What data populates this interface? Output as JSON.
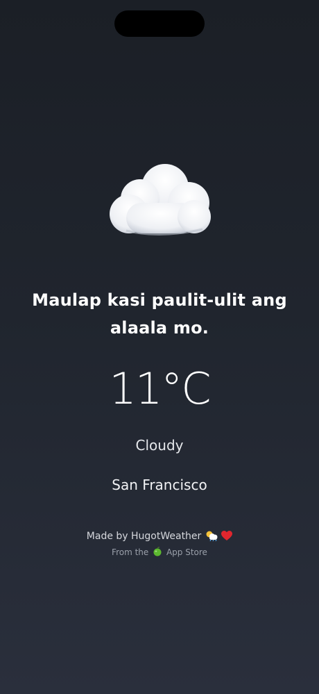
{
  "weather": {
    "quote": "Maulap kasi paulit-ulit ang alaala mo.",
    "temperature": "11°C",
    "condition": "Cloudy",
    "city": "San Francisco",
    "icon": "cloud-icon"
  },
  "footer": {
    "made_by": "Made by HugotWeather",
    "from_prefix": "From the",
    "from_suffix": "App Store",
    "icons": [
      "sun-behind-cloud-icon",
      "heart-icon",
      "apple-icon"
    ]
  },
  "colors": {
    "background_top": "#1b1f26",
    "background_bottom": "#2a2f3c",
    "heart": "#e0262e",
    "apple": "#5cb82f"
  }
}
